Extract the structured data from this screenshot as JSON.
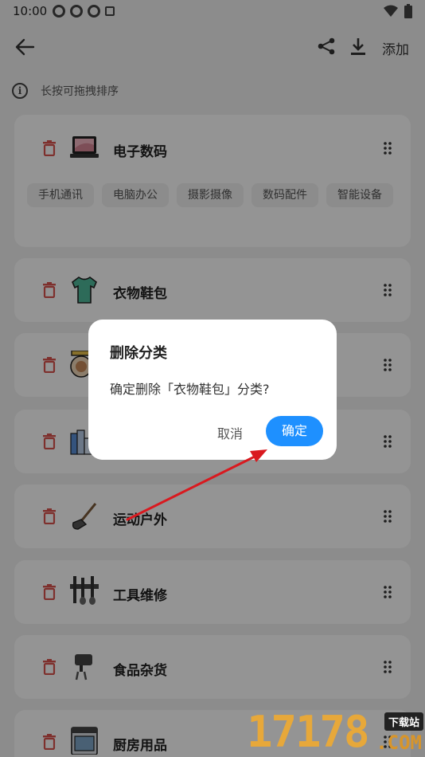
{
  "status_bar": {
    "time": "10:00"
  },
  "app_bar": {
    "add_label": "添加"
  },
  "hint": {
    "text": "长按可拖拽排序",
    "icon": "info-icon"
  },
  "categories": [
    {
      "name": "电子数码",
      "icon": "laptop-icon",
      "subs": [
        "手机通讯",
        "电脑办公",
        "摄影摄像",
        "数码配件",
        "智能设备"
      ]
    },
    {
      "name": "衣物鞋包",
      "icon": "tshirt-icon"
    },
    {
      "name": "",
      "icon": "scale-icon"
    },
    {
      "name": "",
      "icon": "books-icon"
    },
    {
      "name": "运动户外",
      "icon": "racket-icon"
    },
    {
      "name": "工具维修",
      "icon": "tools-icon"
    },
    {
      "name": "食品杂货",
      "icon": "mixer-icon"
    },
    {
      "name": "厨房用品",
      "icon": "oven-icon"
    }
  ],
  "dialog": {
    "title": "删除分类",
    "message": "确定删除「衣物鞋包」分类?",
    "cancel_label": "取消",
    "confirm_label": "确定"
  },
  "watermark": {
    "number": "17178",
    "tag": "下载站",
    "domain": ".COM"
  },
  "colors": {
    "accent": "#1e90ff",
    "trash": "#d9534f",
    "overlay": "rgba(0,0,0,0.42)",
    "annotation_arrow": "#d9191f"
  }
}
